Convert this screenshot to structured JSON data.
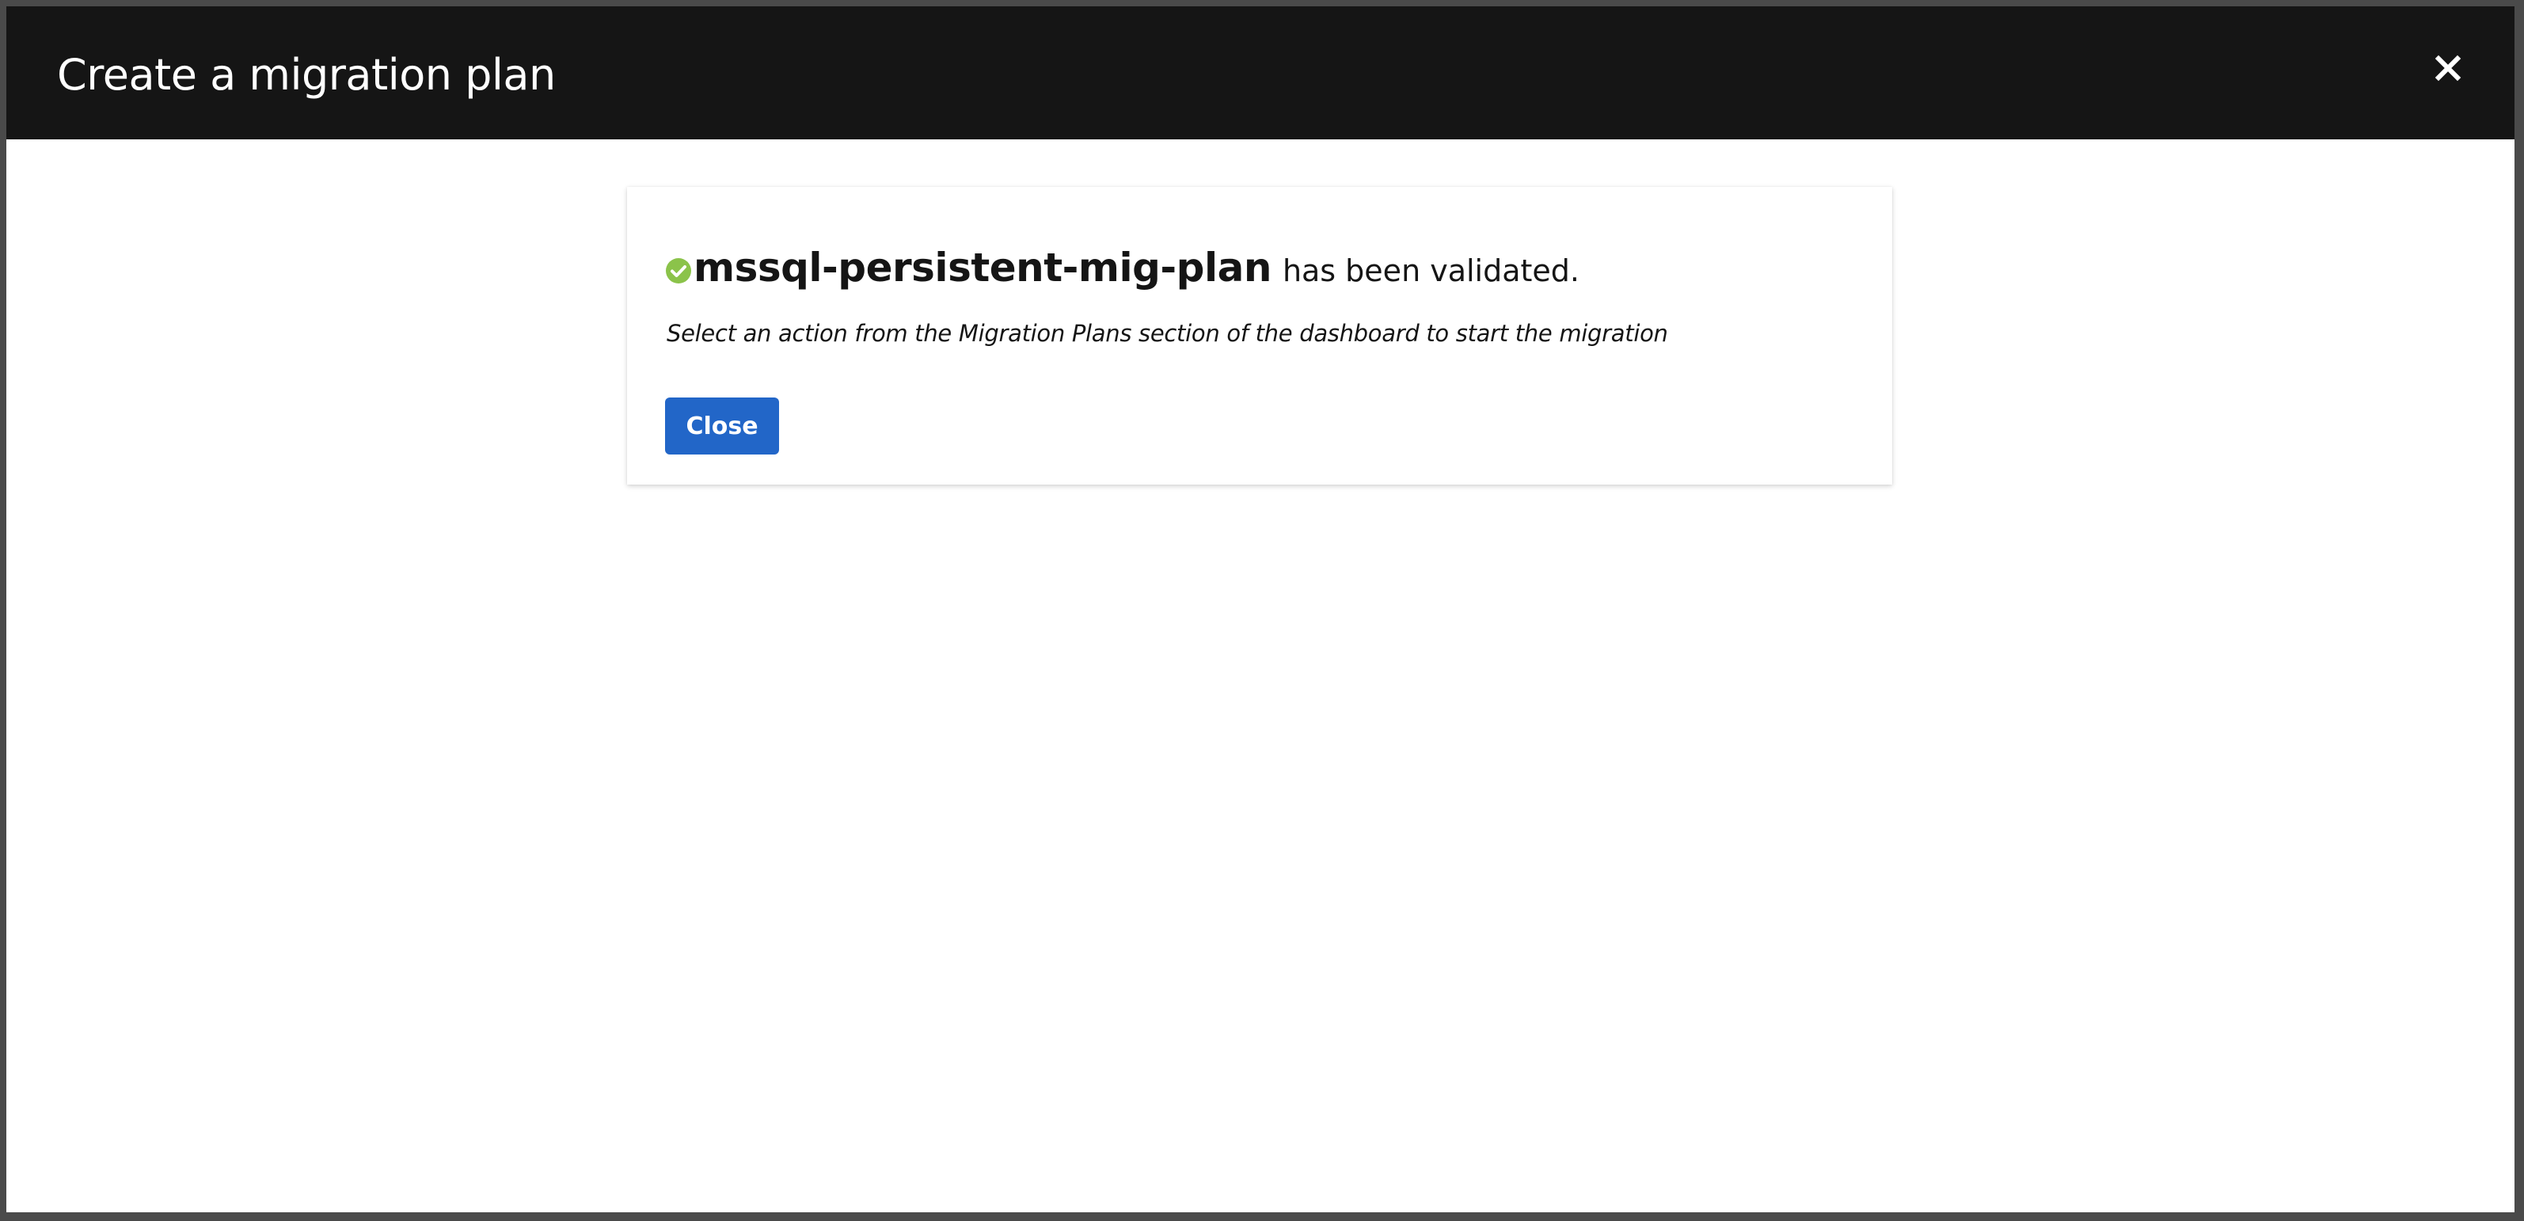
{
  "modal": {
    "title": "Create a migration plan",
    "close_icon": "close-icon"
  },
  "card": {
    "status_icon": "check-circle-icon",
    "status_color": "#8bc34a",
    "plan_name": "mssql-persistent-mig-plan",
    "status_text": "has been validated.",
    "instructions": "Select an action from the Migration Plans section of the dashboard to start the migration",
    "close_label": "Close",
    "button_color": "#2266c8"
  }
}
